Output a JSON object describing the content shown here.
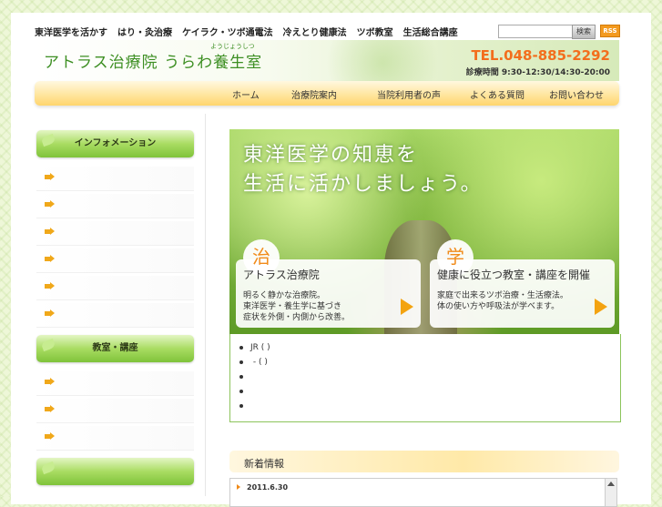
{
  "topnav": [
    "東洋医学を活かす",
    "はり・灸治療",
    "ケイラク・ツボ通電法",
    "冷えとり健康法",
    "ツボ教室",
    "生活総合講座"
  ],
  "search": {
    "placeholder": "",
    "button": "検索",
    "rss": "RSS"
  },
  "header": {
    "logo": "アトラス治療院 うらわ養生室",
    "logo_kana": "ようじょうしつ",
    "tel": "TEL.048-885-2292",
    "hours": "診療時間 9:30-12:30/14:30-20:00"
  },
  "mainnav": [
    "ホーム",
    "治療院案内",
    "当院利用者の声",
    "よくある質問",
    "お問い合わせ"
  ],
  "sidebar": {
    "info_title": "インフォメーション",
    "class_title": "教室・講座",
    "third_title": ""
  },
  "hero": {
    "title_line1": "東洋医学の知恵を",
    "title_line2": "生活に活かしましょう。",
    "box1": {
      "kanji": "治",
      "title": "アトラス治療院",
      "lines": [
        "明るく静かな治療院。",
        "東洋医学・養生学に基づき",
        "症状を外側・内側から改善。"
      ]
    },
    "box2": {
      "kanji": "学",
      "title": "健康に役立つ教室・講座を開催",
      "lines": [
        "家庭で出来るツボ治療・生活療法。",
        "体の使い方や呼吸法が学べます。"
      ]
    }
  },
  "notice": [
    "JR  (  )",
    " -              (  )",
    "",
    "",
    ""
  ],
  "news": {
    "title": "新着情報",
    "items": [
      {
        "date": "2011.6.30"
      }
    ]
  },
  "colors": {
    "accent_green": "#3d8f23",
    "tel_orange": "#f36e1d",
    "nav_yellow": "#ffe6a0"
  }
}
